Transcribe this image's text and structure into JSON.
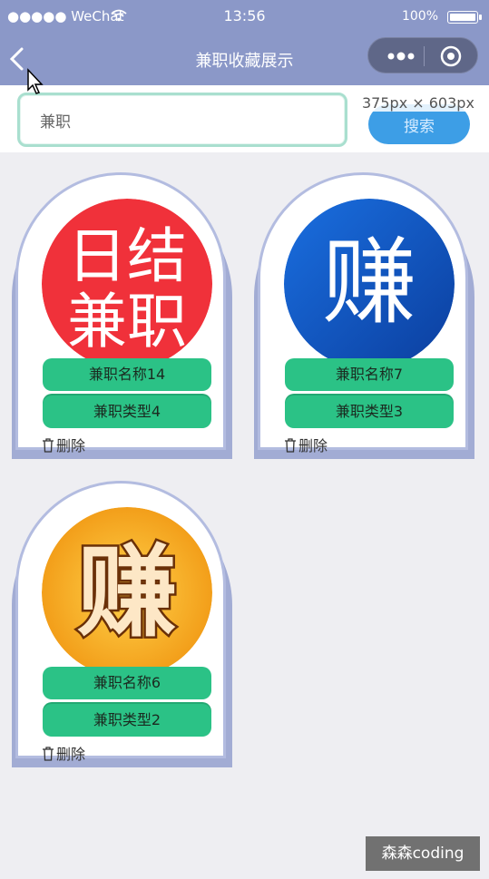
{
  "status_bar": {
    "carrier": "●●●●● WeChat",
    "time": "13:56",
    "battery": "100%"
  },
  "nav": {
    "title": "兼职收藏展示"
  },
  "search": {
    "value": "兼职",
    "button_label": "搜索"
  },
  "dimension_overlay": "375px × 603px",
  "cards": [
    {
      "name": "兼职名称14",
      "type": "兼职类型4",
      "delete_label": "删除",
      "image_text_top": "日结",
      "image_text_bottom": "兼职",
      "image_color": "#f0313a"
    },
    {
      "name": "兼职名称7",
      "type": "兼职类型3",
      "delete_label": "删除",
      "image_text": "赚",
      "image_color": "#1456c4"
    },
    {
      "name": "兼职名称6",
      "type": "兼职类型2",
      "delete_label": "删除",
      "image_text": "赚",
      "image_color": "#f2a21a"
    }
  ],
  "watermark": "森森coding",
  "colors": {
    "nav_background": "#8b98c8",
    "pill_green": "#2bc286",
    "search_button": "#3d9ee6"
  }
}
